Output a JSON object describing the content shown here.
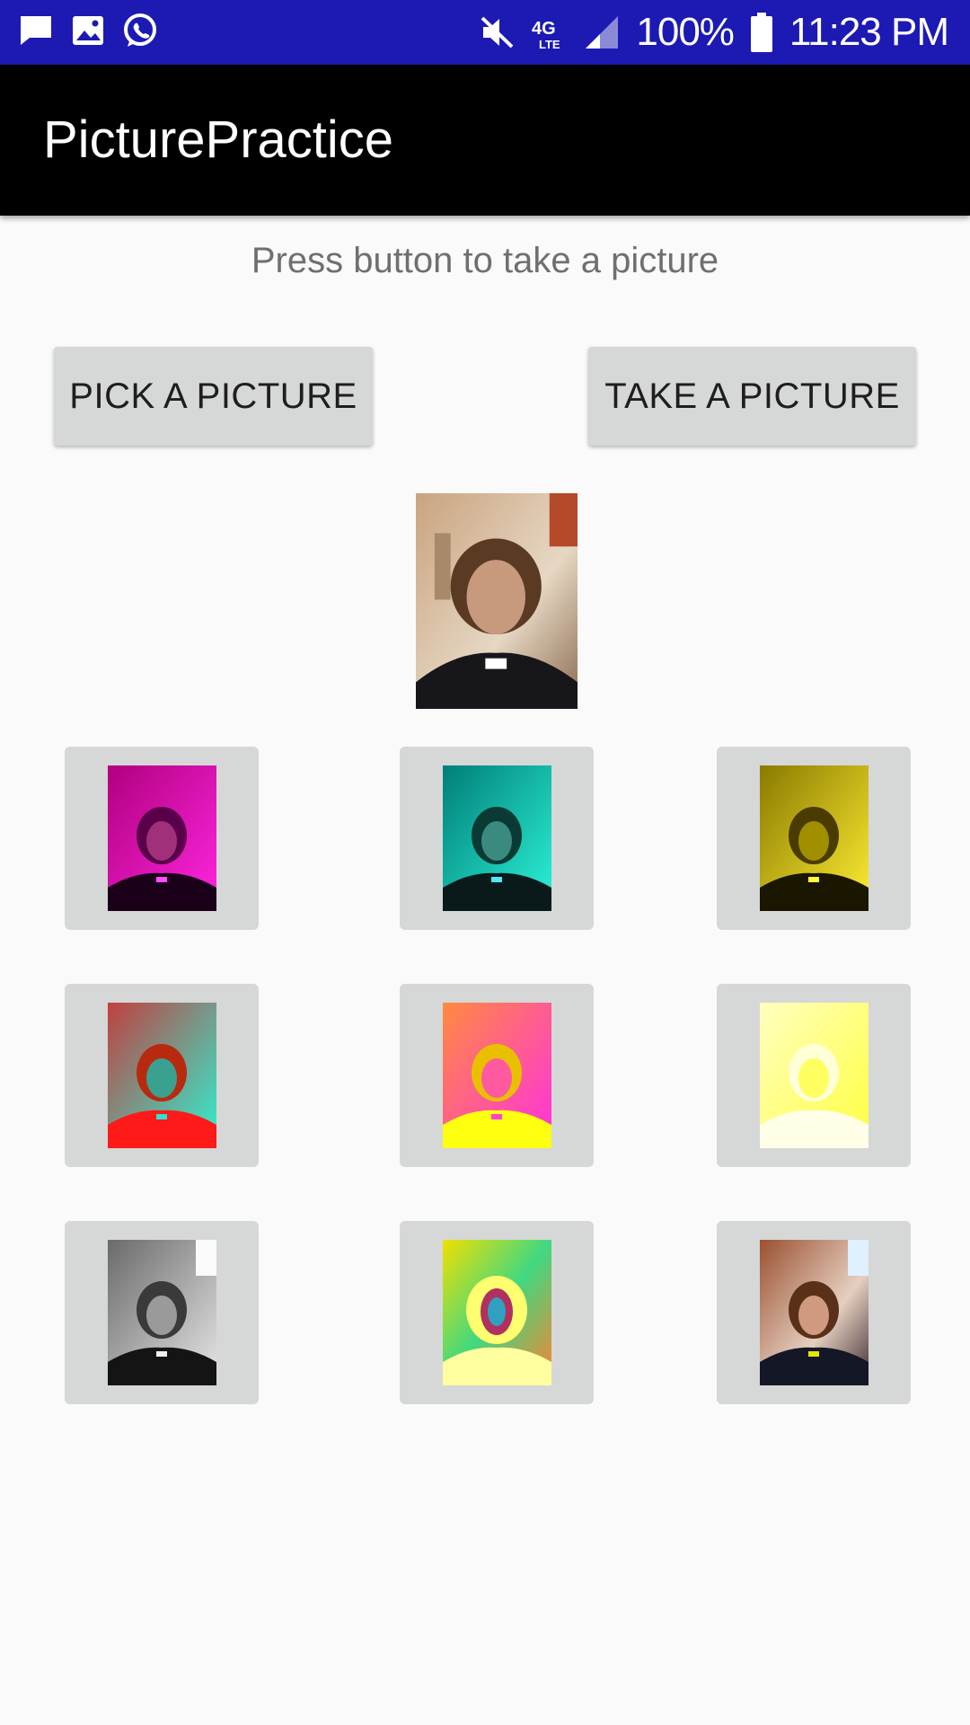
{
  "status_bar": {
    "battery": "100%",
    "time": "11:23 PM",
    "network": "4G LTE",
    "icons": [
      "message-icon",
      "image-icon",
      "whatsapp-icon",
      "mute-icon",
      "network-4g-lte-icon",
      "signal-icon",
      "battery-icon"
    ],
    "background_color": "#1c1ab3"
  },
  "app_bar": {
    "title": "PicturePractice",
    "background_color": "#000000"
  },
  "main": {
    "instruction": "Press button to take a picture",
    "pick_button_label": "PICK A PICTURE",
    "take_button_label": "TAKE A PICTURE"
  },
  "filters": [
    {
      "name": "magenta",
      "tint": "#cc00aa"
    },
    {
      "name": "teal",
      "tint": "#00c6b0"
    },
    {
      "name": "yellow",
      "tint": "#c9b400"
    },
    {
      "name": "red-cyan",
      "tint": "#ff2a2a"
    },
    {
      "name": "pink-yellow",
      "tint": "#ff55cc"
    },
    {
      "name": "bright-yellow",
      "tint": "#ffff66"
    },
    {
      "name": "grayscale",
      "tint": "#888888"
    },
    {
      "name": "psychedelic",
      "tint": "#e4e000"
    },
    {
      "name": "warm-original",
      "tint": "#a06040"
    }
  ]
}
